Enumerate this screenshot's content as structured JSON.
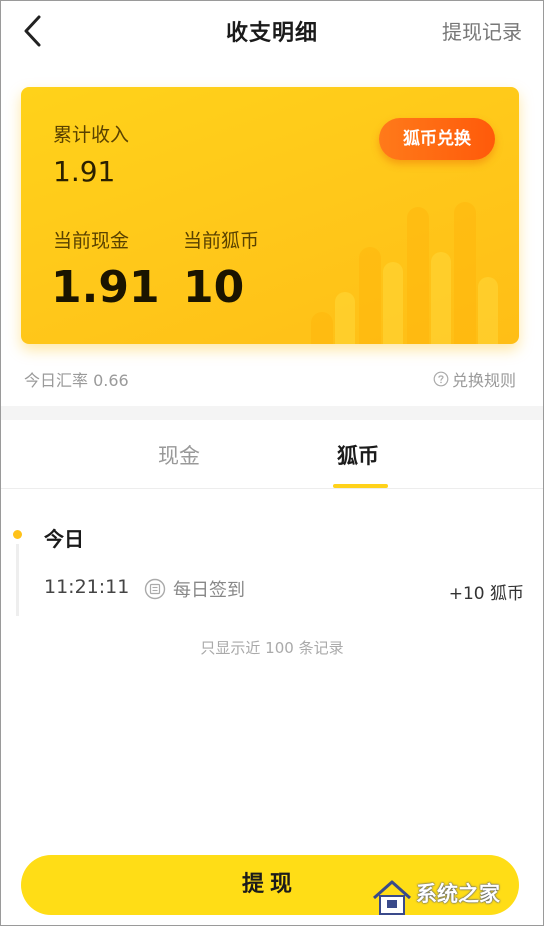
{
  "header": {
    "title": "收支明细",
    "history_link": "提现记录"
  },
  "card": {
    "total_income_label": "累计收入",
    "total_income_value": "1.91",
    "exchange_button": "狐币兑换",
    "current_cash_label": "当前现金",
    "current_cash_value": "1.91",
    "current_coins_label": "当前狐币",
    "current_coins_value": "10"
  },
  "rate": {
    "text": "今日汇率 0.66",
    "rules_link": "兑换规则"
  },
  "tabs": [
    {
      "label": "现金",
      "active": false
    },
    {
      "label": "狐币",
      "active": true
    }
  ],
  "records": {
    "day_label": "今日",
    "items": [
      {
        "time": "11:21:11",
        "description": "每日签到",
        "amount": "+10 狐币"
      }
    ],
    "note": "只显示近 100 条记录"
  },
  "footer": {
    "withdraw_button": "提现"
  },
  "watermark": {
    "text": "系统之家"
  },
  "colors": {
    "card_yellow": "#ffc81a",
    "exchange_orange": "#ff6a12",
    "tab_indicator": "#ffd21a",
    "withdraw_yellow": "#ffdd16"
  },
  "icons": [
    "back-arrow-icon",
    "question-circle-icon",
    "sign-in-icon",
    "watermark-house-icon"
  ]
}
